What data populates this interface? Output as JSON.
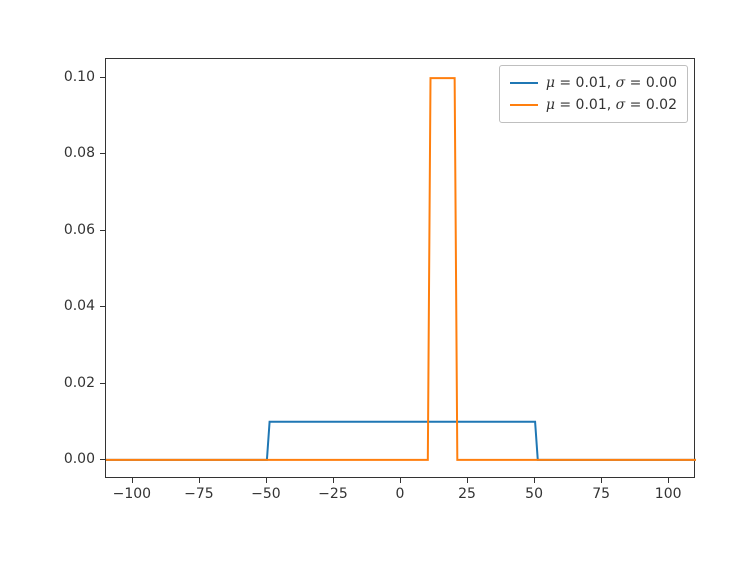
{
  "chart_data": {
    "type": "line",
    "title": "",
    "xlabel": "",
    "ylabel": "",
    "xlim": [
      -110,
      110
    ],
    "ylim": [
      -0.005,
      0.105
    ],
    "xticks": [
      -100,
      -75,
      -50,
      -25,
      0,
      25,
      50,
      75,
      100
    ],
    "yticks": [
      0.0,
      0.02,
      0.04,
      0.06,
      0.08,
      0.1
    ],
    "xtick_labels": [
      "−100",
      "−75",
      "−50",
      "−25",
      "0",
      "25",
      "50",
      "75",
      "100"
    ],
    "ytick_labels": [
      "0.00",
      "0.02",
      "0.04",
      "0.06",
      "0.08",
      "0.10"
    ],
    "legend_position": "upper right",
    "series": [
      {
        "name": "μ = 0.01,  σ = 0.00",
        "color": "#1f77b4",
        "x": [
          -110,
          -50,
          -49,
          50,
          51,
          110
        ],
        "y": [
          0.0,
          0.0,
          0.01,
          0.01,
          0.0,
          0.0
        ]
      },
      {
        "name": "μ = 0.01,  σ = 0.02",
        "color": "#ff7f0e",
        "x": [
          -110,
          10,
          11,
          20,
          21,
          110
        ],
        "y": [
          0.0,
          0.0,
          0.1,
          0.1,
          0.0,
          0.0
        ]
      }
    ]
  },
  "layout": {
    "fig_w": 750,
    "fig_h": 563,
    "axes_left": 105,
    "axes_top": 58,
    "axes_width": 590,
    "axes_height": 420
  }
}
